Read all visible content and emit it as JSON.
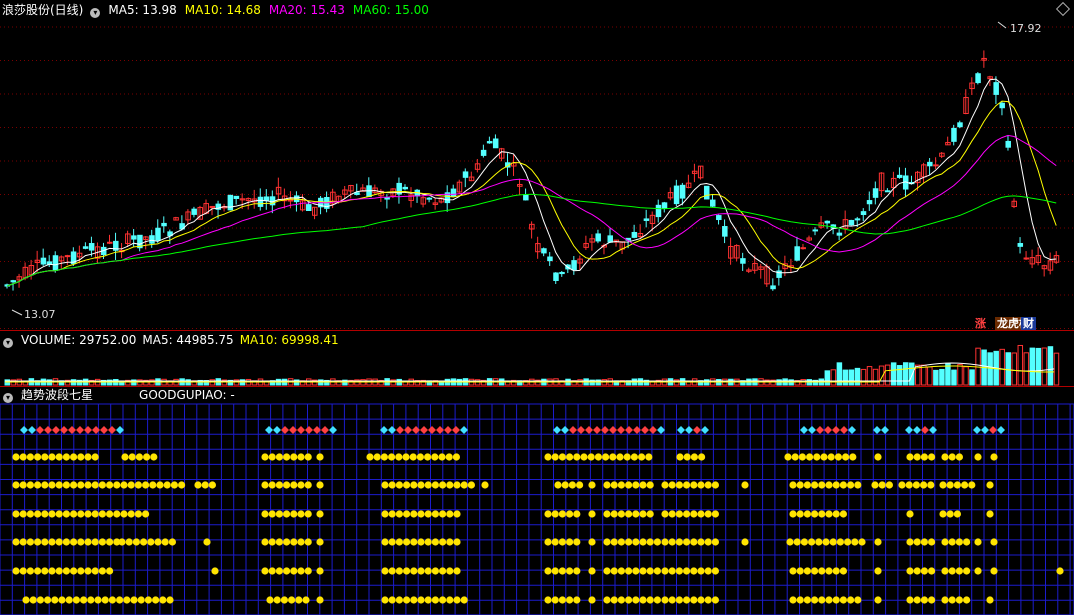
{
  "main": {
    "stock_name": "浪莎股份(日线)",
    "ma5": "MA5: 13.98",
    "ma10": "MA10: 14.68",
    "ma20": "MA20: 15.43",
    "ma60": "MA60: 15.00",
    "high_label": "17.92",
    "low_label": "13.07",
    "tags": [
      "涨",
      "龙虎榜",
      "财"
    ],
    "colors": {
      "ma5": "#ffffff",
      "ma10": "#ffff00",
      "ma20": "#ff00ff",
      "ma60": "#00ff00",
      "up": "#ff3232",
      "down": "#54ffff"
    }
  },
  "volume": {
    "title": "VOLUME: 29752.00",
    "ma5": "MA5: 44985.75",
    "ma10": "MA10: 69998.41"
  },
  "indicator": {
    "title": "趋势波段七星",
    "subtitle": "GOODGUPIAO: -"
  }
}
